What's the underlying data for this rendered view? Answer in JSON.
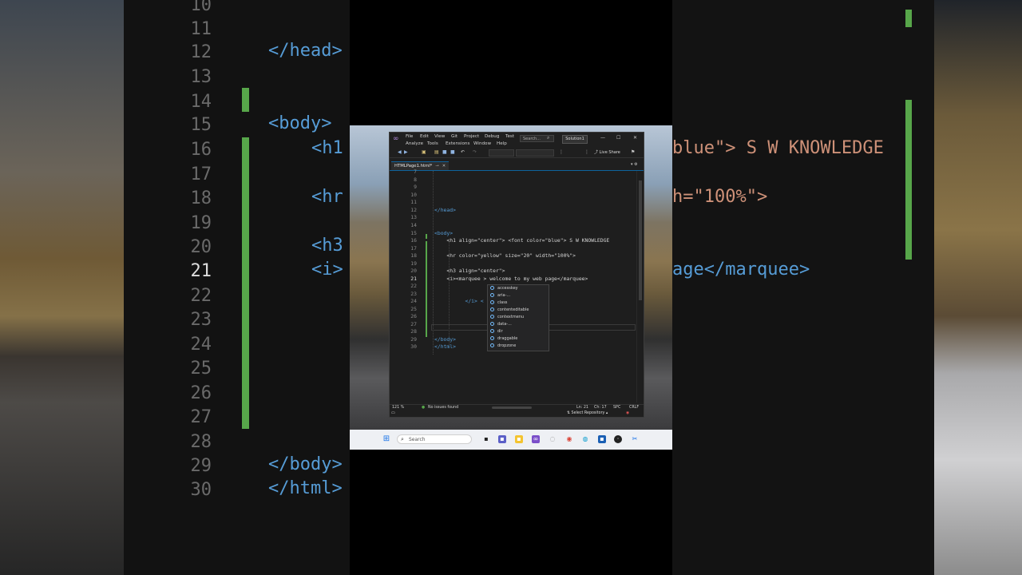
{
  "background_zoom": {
    "lines": [
      {
        "num": "10",
        "code": ""
      },
      {
        "num": "11",
        "code": ""
      },
      {
        "num": "12",
        "code": "</head>"
      },
      {
        "num": "13",
        "code": ""
      },
      {
        "num": "14",
        "code": ""
      },
      {
        "num": "15",
        "code": "<body>"
      },
      {
        "num": "16",
        "code": "<h1"
      },
      {
        "num": "17",
        "code": ""
      },
      {
        "num": "18",
        "code": "<hr"
      },
      {
        "num": "19",
        "code": ""
      },
      {
        "num": "20",
        "code": "<h3"
      },
      {
        "num": "21",
        "code": "<i>"
      },
      {
        "num": "22",
        "code": ""
      },
      {
        "num": "23",
        "code": ""
      },
      {
        "num": "24",
        "code": ""
      },
      {
        "num": "25",
        "code": ""
      },
      {
        "num": "26",
        "code": ""
      },
      {
        "num": "27",
        "code": ""
      },
      {
        "num": "28",
        "code": ""
      },
      {
        "num": "29",
        "code": "</body>"
      },
      {
        "num": "30",
        "code": "</html>"
      }
    ],
    "right_frag_1": "blue\"> S W KNOWLEDGE",
    "right_frag_2": "h=\"100%\">",
    "right_frag_3": "age</marquee>"
  },
  "vs": {
    "menu_row1": [
      "File",
      "Edit",
      "View",
      "Git",
      "Project",
      "Debug",
      "Test"
    ],
    "menu_row2": [
      "Analyze",
      "Tools",
      "Extensions",
      "Window",
      "Help"
    ],
    "search_placeholder": "Search...",
    "solution_label": "Solution1",
    "live_share": "Live Share",
    "tab_label": "HTMLPage1.html*",
    "lines": [
      {
        "num": "7",
        "code": ""
      },
      {
        "num": "8",
        "code": ""
      },
      {
        "num": "9",
        "code": ""
      },
      {
        "num": "10",
        "code": ""
      },
      {
        "num": "11",
        "code": ""
      },
      {
        "num": "12",
        "code": "</head>"
      },
      {
        "num": "13",
        "code": ""
      },
      {
        "num": "14",
        "code": ""
      },
      {
        "num": "15",
        "code": "<body>"
      },
      {
        "num": "16",
        "code": "    <h1 align=\"center\"> <font color=\"blue\"> S W KNOWLEDGE"
      },
      {
        "num": "17",
        "code": ""
      },
      {
        "num": "18",
        "code": "    <hr color=\"yellow\" size=\"20\" width=\"100%\">"
      },
      {
        "num": "19",
        "code": ""
      },
      {
        "num": "20",
        "code": "    <h3 align=\"center\">"
      },
      {
        "num": "21",
        "code": "    <i><marquee > welcome to my web page</marquee>"
      },
      {
        "num": "22",
        "code": ""
      },
      {
        "num": "23",
        "code": ""
      },
      {
        "num": "24",
        "code": "          </i> <"
      },
      {
        "num": "25",
        "code": ""
      },
      {
        "num": "26",
        "code": ""
      },
      {
        "num": "27",
        "code": ""
      },
      {
        "num": "28",
        "code": ""
      },
      {
        "num": "29",
        "code": "</body>"
      },
      {
        "num": "30",
        "code": "</html>"
      }
    ],
    "intellisense": [
      "accesskey",
      "aria-...",
      "class",
      "contenteditable",
      "contextmenu",
      "data-...",
      "dir",
      "draggable",
      "dropzone"
    ],
    "status": {
      "zoom": "121 %",
      "issues": "No issues found",
      "line": "Ln: 21",
      "col": "Ch: 17",
      "spc": "SPC",
      "eol": "CRLF"
    },
    "select_repository": "Select Repository"
  },
  "taskbar": {
    "search_placeholder": "Search"
  }
}
